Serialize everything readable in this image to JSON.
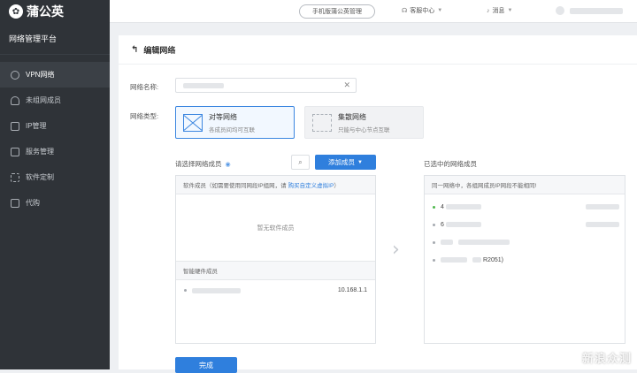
{
  "brand": {
    "name": "蒲公英",
    "platform": "网络管理平台"
  },
  "sidebar": {
    "items": [
      {
        "label": "VPN网络",
        "icon": "link-icon",
        "active": true
      },
      {
        "label": "未组网成员",
        "icon": "user-icon",
        "active": false
      },
      {
        "label": "IP管理",
        "icon": "ip-icon",
        "active": false
      },
      {
        "label": "服务管理",
        "icon": "service-icon",
        "active": false
      },
      {
        "label": "软件定制",
        "icon": "grid-icon",
        "active": false
      },
      {
        "label": "代购",
        "icon": "cart-icon",
        "active": false
      }
    ]
  },
  "topbar": {
    "mobile_button": "手机版蒲公英管理",
    "help": "客服中心",
    "messages": "消息"
  },
  "page": {
    "title": "编辑网络"
  },
  "form": {
    "name_label": "网络名称:",
    "type_label": "网络类型:",
    "types": [
      {
        "title": "对等网络",
        "desc": "各成员间均可互联",
        "selected": true
      },
      {
        "title": "集散网络",
        "desc": "只能与中心节点互联",
        "selected": false
      }
    ]
  },
  "left": {
    "title": "请选择网络成员",
    "add_button": "添加成员",
    "software_header": "软件成员（如需要使用同网段IP组网，请",
    "software_link": "购买自定义虚拟IP",
    "software_header_end": "）",
    "empty": "暂无软件成员",
    "hardware_header": "智能硬件成员",
    "hardware_members": [
      {
        "ip": "10.168.1.1"
      }
    ]
  },
  "right": {
    "title": "已选中的网络成员",
    "note": "同一网络中，各组网成员IP网段不能相同!",
    "members": [
      {
        "prefix": "4",
        "suffix": ""
      },
      {
        "prefix": "6",
        "suffix": ""
      },
      {
        "prefix": "",
        "suffix": ""
      },
      {
        "prefix": "",
        "suffix": "R2051)"
      }
    ]
  },
  "actions": {
    "done": "完成"
  },
  "watermark": "新浪众测",
  "colors": {
    "accent": "#2f7fdd",
    "sidebar": "#2f3338"
  }
}
